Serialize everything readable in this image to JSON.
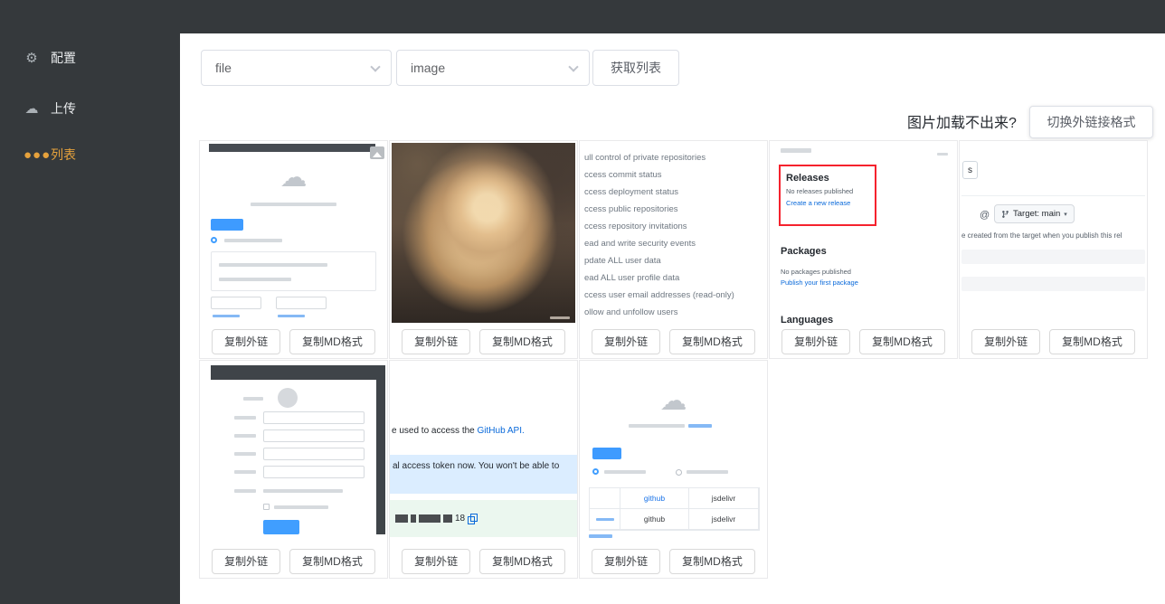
{
  "app": {
    "dark_bg": "#35393c",
    "accent_orange": "#e6a23c",
    "accent_blue": "#409eff"
  },
  "sidebar": {
    "items": [
      {
        "label": "配置"
      },
      {
        "label": "上传"
      },
      {
        "label": "列表"
      }
    ]
  },
  "toolbar": {
    "dropdown_file_value": "file",
    "dropdown_image_value": "image",
    "fetch_list_label": "获取列表"
  },
  "tip": {
    "question": "图片加载不出来?",
    "switch_button_label": "切换外链接格式"
  },
  "actions": {
    "copy_link_label": "复制外链",
    "copy_md_label": "复制MD格式"
  },
  "thumbs": {
    "scopes": {
      "lines": [
        "ull control of private repositories",
        "ccess commit status",
        "ccess deployment status",
        "ccess public repositories",
        "ccess repository invitations",
        "ead and write security events",
        "pdate ALL user data",
        "ead ALL user profile data",
        "ccess user email addresses (read-only)",
        "ollow and unfollow users"
      ]
    },
    "releases": {
      "releases_title": "Releases",
      "releases_sub": "No releases published",
      "releases_link": "Create a new release",
      "packages_title": "Packages",
      "packages_sub": "No packages published",
      "packages_link": "Publish your first package",
      "languages_title": "Languages"
    },
    "release_form": {
      "corner": "s",
      "at": "@",
      "target_label": "Target: main",
      "caption": "e created from the target when you publish this rel"
    },
    "token": {
      "line_prefix": "e used to access the ",
      "line_link": "GitHub API.",
      "notice": "al access token now. You won't be able to",
      "token_tail": "18"
    },
    "cdn": {
      "r1c1": "github",
      "r1c2": "jsdelivr",
      "r2c1": "github",
      "r2c2": "jsdelivr"
    }
  }
}
